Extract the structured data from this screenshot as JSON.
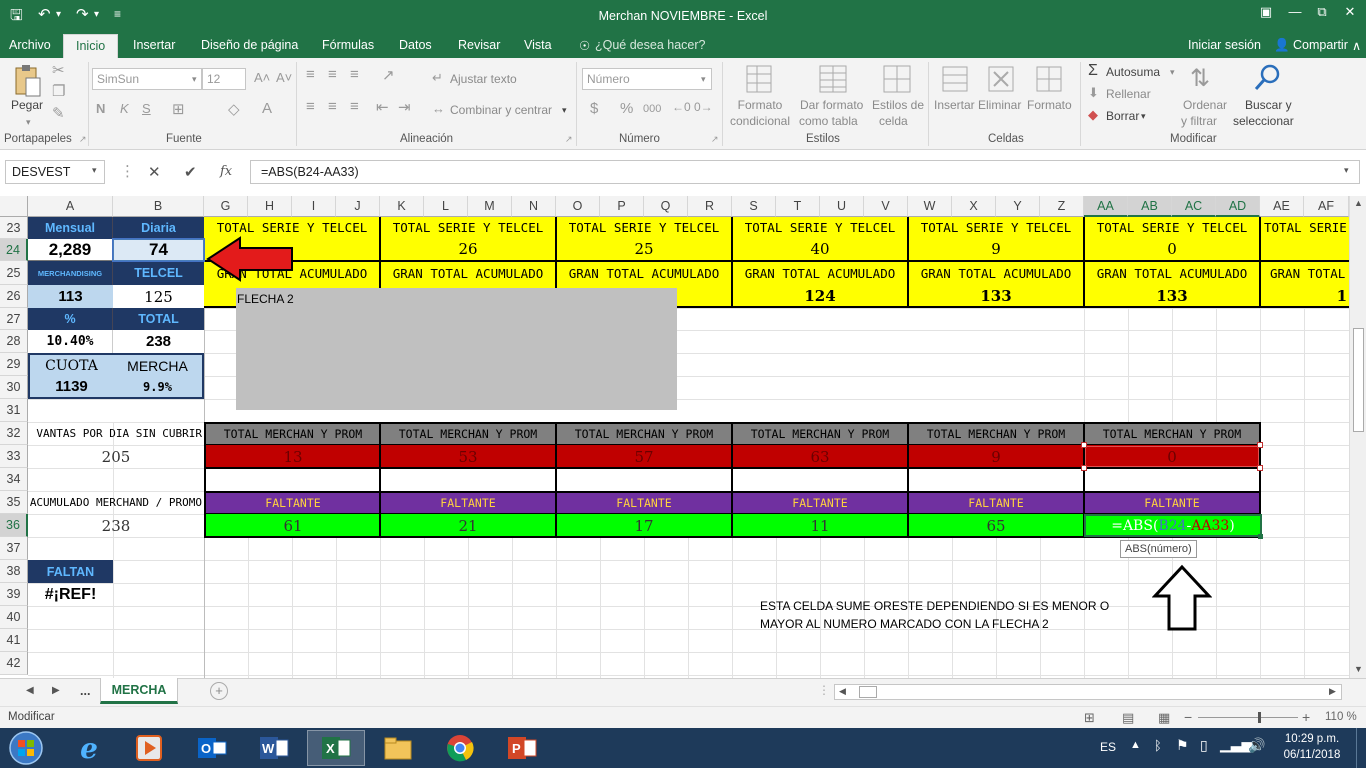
{
  "window": {
    "title": "Merchan NOVIEMBRE - Excel",
    "account": "Iniciar sesión",
    "share": "Compartir",
    "tell_me": "¿Qué desea hacer?"
  },
  "menu_tabs": [
    "Archivo",
    "Inicio",
    "Insertar",
    "Diseño de página",
    "Fórmulas",
    "Datos",
    "Revisar",
    "Vista"
  ],
  "active_tab": "Inicio",
  "ribbon": {
    "paste": "Pegar",
    "font_name": "SimSun",
    "font_size": "12",
    "bold": "N",
    "italic": "K",
    "underline": "S",
    "wrap_text": "Ajustar texto",
    "merge": "Combinar y centrar",
    "number_format": "Número",
    "currency": "$",
    "percent": "%",
    "thousands": "000",
    "conditional": [
      "Formato",
      "condicional"
    ],
    "as_table": [
      "Dar formato",
      "como tabla"
    ],
    "cell_styles": [
      "Estilos de",
      "celda"
    ],
    "insert": "Insertar",
    "delete": "Eliminar",
    "format": "Formato",
    "autosum": "Autosuma",
    "fill": "Rellenar",
    "clear": "Borrar",
    "sort": [
      "Ordenar",
      "y filtrar"
    ],
    "find": [
      "Buscar y",
      "seleccionar"
    ],
    "groups": [
      "Portapapeles",
      "Fuente",
      "Alineación",
      "Número",
      "Estilos",
      "Celdas",
      "Modificar"
    ]
  },
  "formula_bar": {
    "name_box": "DESVEST",
    "formula": "=ABS(B24-AA33)",
    "fx": "fx"
  },
  "columns": [
    "A",
    "B",
    "G",
    "H",
    "I",
    "J",
    "K",
    "L",
    "M",
    "N",
    "O",
    "P",
    "Q",
    "R",
    "S",
    "T",
    "U",
    "V",
    "W",
    "X",
    "Y",
    "Z",
    "AA",
    "AB",
    "AC",
    "AD",
    "AE",
    "AF"
  ],
  "rows": [
    "23",
    "24",
    "25",
    "26",
    "27",
    "28",
    "29",
    "30",
    "31",
    "32",
    "33",
    "34",
    "35",
    "36",
    "37",
    "38",
    "39",
    "40",
    "41",
    "42"
  ],
  "left_table": {
    "mensual_label": "Mensual",
    "diaria_label": "Diaria",
    "mensual": "2,289",
    "diaria": "74",
    "merch_label": "MERCHANDISING",
    "telcel_label": "TELCEL",
    "merch": "113",
    "telcel": "125",
    "pct_label": "%",
    "total_label": "TOTAL",
    "pct": "10.40%",
    "total": "238",
    "cuota_label": "CUOTA",
    "mercha_label": "MERCHA",
    "cuota": "1139",
    "mercha": "9.9%",
    "ventas_label": "VANTAS POR DIA SIN CUBRIR",
    "ventas": "205",
    "acum_label": "ACUMULADO MERCHAND / PROMO",
    "acum": "238",
    "faltan_label": "FALTAN",
    "faltan": "#¡REF!"
  },
  "blocks": {
    "serie_label": "TOTAL SERIE Y TELCEL",
    "serie_values": [
      "",
      "26",
      "25",
      "40",
      "9",
      "0",
      ""
    ],
    "gran_label": "GRAN TOTAL ACUMULADO",
    "gran_values": [
      "",
      "",
      "",
      "124",
      "133",
      "133",
      "1"
    ],
    "merchan_label": "TOTAL MERCHAN Y PROM",
    "merchan_values": [
      "13",
      "53",
      "57",
      "63",
      "9",
      "0"
    ],
    "faltante_label": "FALTANTE",
    "faltante_values": [
      "61",
      "21",
      "17",
      "11",
      "65"
    ],
    "editing_formula": {
      "prefix": "=ABS(",
      "ref1": "B24",
      "sep": "-",
      "ref2": "AA33",
      "suffix": ")"
    },
    "tooltip": "ABS(número)"
  },
  "shape": {
    "label": "FLECHA 2"
  },
  "note": {
    "line1": "ESTA CELDA SUME ORESTE DEPENDIENDO SI ES MENOR O",
    "line2": "MAYOR AL NUMERO MARCADO CON LA FLECHA 2"
  },
  "sheet_tabs": {
    "more": "...",
    "active": "MERCHA"
  },
  "status": {
    "mode": "Modificar",
    "zoom": "110 %"
  },
  "taskbar": {
    "lang": "ES",
    "time": "10:29 p.m.",
    "date": "06/11/2018"
  },
  "colors": {
    "excel_green": "#217346",
    "yellow": "#ffff00",
    "dark_blue": "#1f3864",
    "light_blue": "#bdd7ee",
    "gray_header": "#808080",
    "red": "#c00000",
    "purple": "#7030a0",
    "lime": "#00ff00",
    "shape_gray": "#c0c0c0",
    "arrow_red": "#e31b1b"
  }
}
